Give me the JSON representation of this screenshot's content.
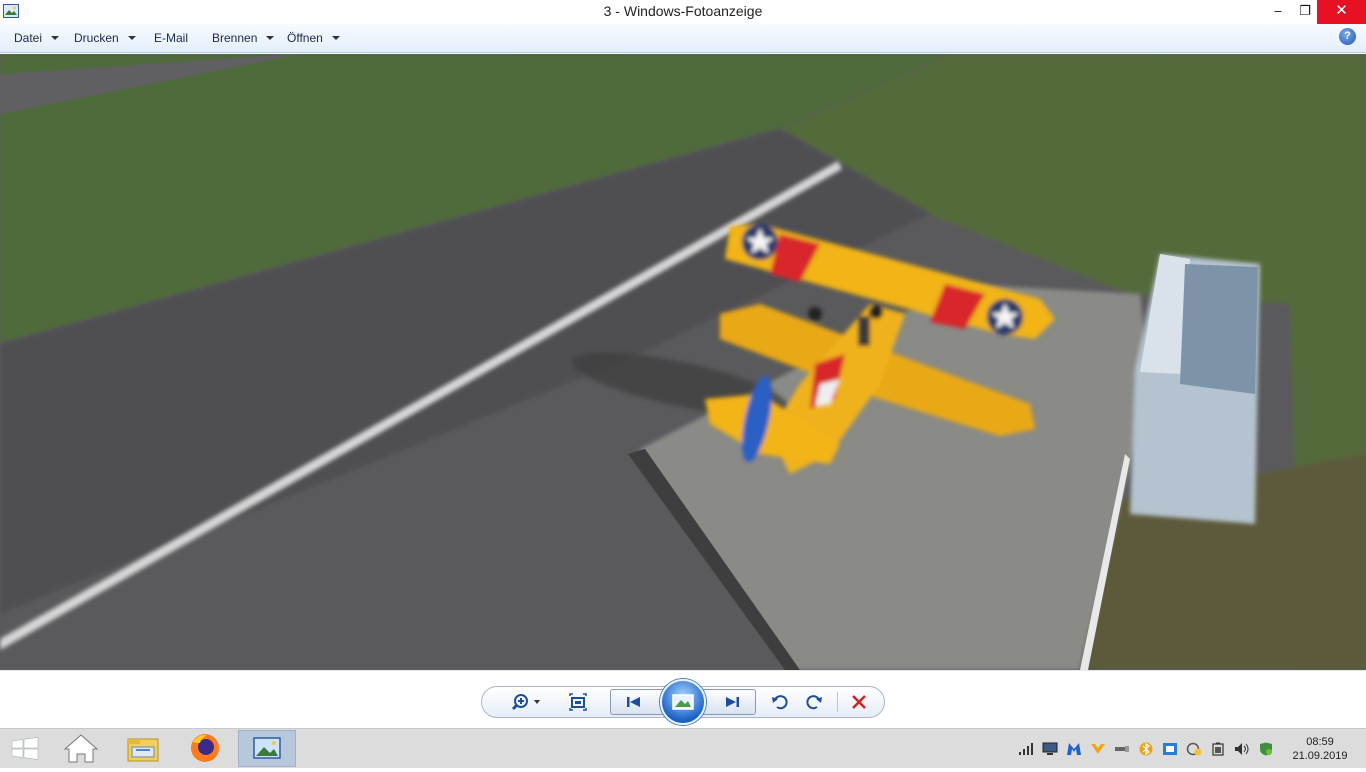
{
  "window": {
    "title": "3 - Windows-Fotoanzeige",
    "minimize_glyph": "–",
    "maximize_glyph": "❐",
    "close_glyph": "✕"
  },
  "menu": {
    "items": [
      {
        "label": "Datei",
        "has_dropdown": true
      },
      {
        "label": "Drucken",
        "has_dropdown": true
      },
      {
        "label": "E-Mail",
        "has_dropdown": false
      },
      {
        "label": "Brennen",
        "has_dropdown": true
      },
      {
        "label": "Öffnen",
        "has_dropdown": true
      }
    ],
    "help_glyph": "?"
  },
  "controls": {
    "icons": [
      "zoom-icon",
      "fit-window-icon",
      "previous-icon",
      "slideshow-icon",
      "next-icon",
      "rotate-left-icon",
      "rotate-right-icon",
      "delete-icon"
    ],
    "accent_color": "#1c4f9b",
    "delete_color": "#d42020"
  },
  "taskbar": {
    "apps": [
      "start-icon",
      "home-icon",
      "file-explorer-icon",
      "firefox-icon",
      "photo-viewer-icon"
    ],
    "time": "08:59",
    "date": "21.09.2019"
  }
}
